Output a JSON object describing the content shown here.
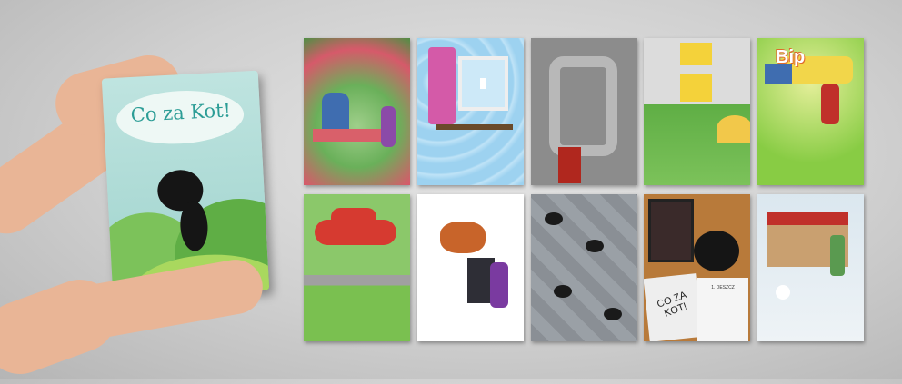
{
  "book": {
    "cover_title": "Co za Kot!"
  },
  "illustrations": {
    "bip_text": "Bip",
    "page_book_title": "CO ZA KOT!",
    "page_chapter": "1. DESZCZ"
  },
  "colors": {
    "cover": "#a8d9d3",
    "title": "#2c9d96",
    "background": "#d0d0d0"
  }
}
